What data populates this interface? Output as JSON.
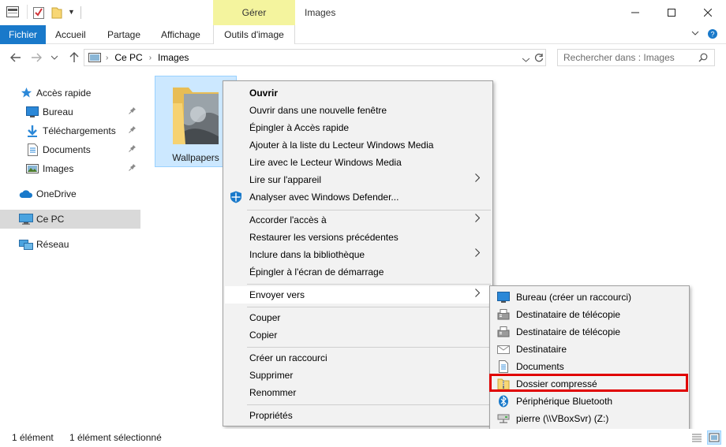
{
  "window": {
    "title": "Images",
    "contextual_tab": "Gérer",
    "contextual_tab_color": "#f4f49e"
  },
  "ribbon": {
    "tabs": [
      {
        "label": "Fichier",
        "icon": null
      },
      {
        "label": "Accueil"
      },
      {
        "label": "Partage"
      },
      {
        "label": "Affichage"
      },
      {
        "label": "Outils d'image"
      }
    ],
    "accent": "#1979ca"
  },
  "address": {
    "path": [
      "Ce PC",
      "Images"
    ],
    "search_placeholder": "Rechercher dans : Images"
  },
  "sidebar": {
    "items": [
      {
        "label": "Accès rapide",
        "icon": "star-icon",
        "pinned": false
      },
      {
        "label": "Bureau",
        "icon": "desktop-icon",
        "pinned": true
      },
      {
        "label": "Téléchargements",
        "icon": "download-icon",
        "pinned": true
      },
      {
        "label": "Documents",
        "icon": "documents-icon",
        "pinned": true
      },
      {
        "label": "Images",
        "icon": "pictures-icon",
        "pinned": true
      },
      {
        "label": "OneDrive",
        "icon": "cloud-icon",
        "pinned": false
      },
      {
        "label": "Ce PC",
        "icon": "computer-icon",
        "pinned": false,
        "selected": true
      },
      {
        "label": "Réseau",
        "icon": "network-icon",
        "pinned": false
      }
    ]
  },
  "content": {
    "folder": {
      "name": "Wallpapers",
      "selected": true
    }
  },
  "context_menu": {
    "items": [
      "Ouvrir",
      "Ouvrir dans une nouvelle fenêtre",
      "Épingler à Accès rapide",
      "Ajouter à la liste du Lecteur Windows Media",
      "Lire avec le Lecteur Windows Media",
      "Lire sur l'appareil",
      "Analyser avec Windows Defender...",
      "Accorder l'accès à",
      "Restaurer les versions précédentes",
      "Inclure dans la bibliothèque",
      "Épingler à l'écran de démarrage",
      "Envoyer vers",
      "Couper",
      "Copier",
      "Créer un raccourci",
      "Supprimer",
      "Renommer",
      "Propriétés"
    ]
  },
  "send_to_menu": {
    "items": [
      {
        "label": "Bureau (créer un raccourci)",
        "icon": "desktop-icon"
      },
      {
        "label": "Destinataire de télécopie",
        "icon": "fax-icon"
      },
      {
        "label": "Destinataire de télécopie",
        "icon": "fax-icon"
      },
      {
        "label": "Destinataire",
        "icon": "mail-icon"
      },
      {
        "label": "Documents",
        "icon": "documents-icon"
      },
      {
        "label": "Dossier compressé",
        "icon": "zip-folder-icon",
        "highlighted": true
      },
      {
        "label": "Périphérique Bluetooth",
        "icon": "bluetooth-icon"
      },
      {
        "label": "pierre (\\\\VBoxSvr) (Z:)",
        "icon": "network-drive-icon"
      }
    ],
    "highlight_color": "#e00000"
  },
  "status": {
    "count": "1 élément",
    "selection": "1 élément sélectionné"
  }
}
